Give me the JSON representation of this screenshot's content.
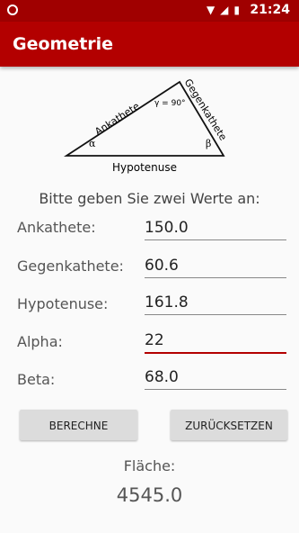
{
  "status_bar": {
    "time": "21:24"
  },
  "app_bar": {
    "title": "Geometrie"
  },
  "diagram": {
    "side_adjacent": "Ankathete",
    "side_opposite": "Gegenkathete",
    "side_hypotenuse": "Hypotenuse",
    "angle_gamma": "γ = 90°",
    "angle_alpha": "α",
    "angle_beta": "β"
  },
  "prompt": "Bitte geben Sie zwei Werte an:",
  "fields": [
    {
      "label": "Ankathete:",
      "value": "150.0"
    },
    {
      "label": "Gegenkathete:",
      "value": "60.6"
    },
    {
      "label": "Hypotenuse:",
      "value": "161.8"
    },
    {
      "label": "Alpha:",
      "value": "22"
    },
    {
      "label": "Beta:",
      "value": "68.0"
    }
  ],
  "buttons": {
    "calculate": "BERECHNE",
    "reset": "ZURÜCKSETZEN"
  },
  "result": {
    "label": "Fläche:",
    "value": "4545.0"
  }
}
